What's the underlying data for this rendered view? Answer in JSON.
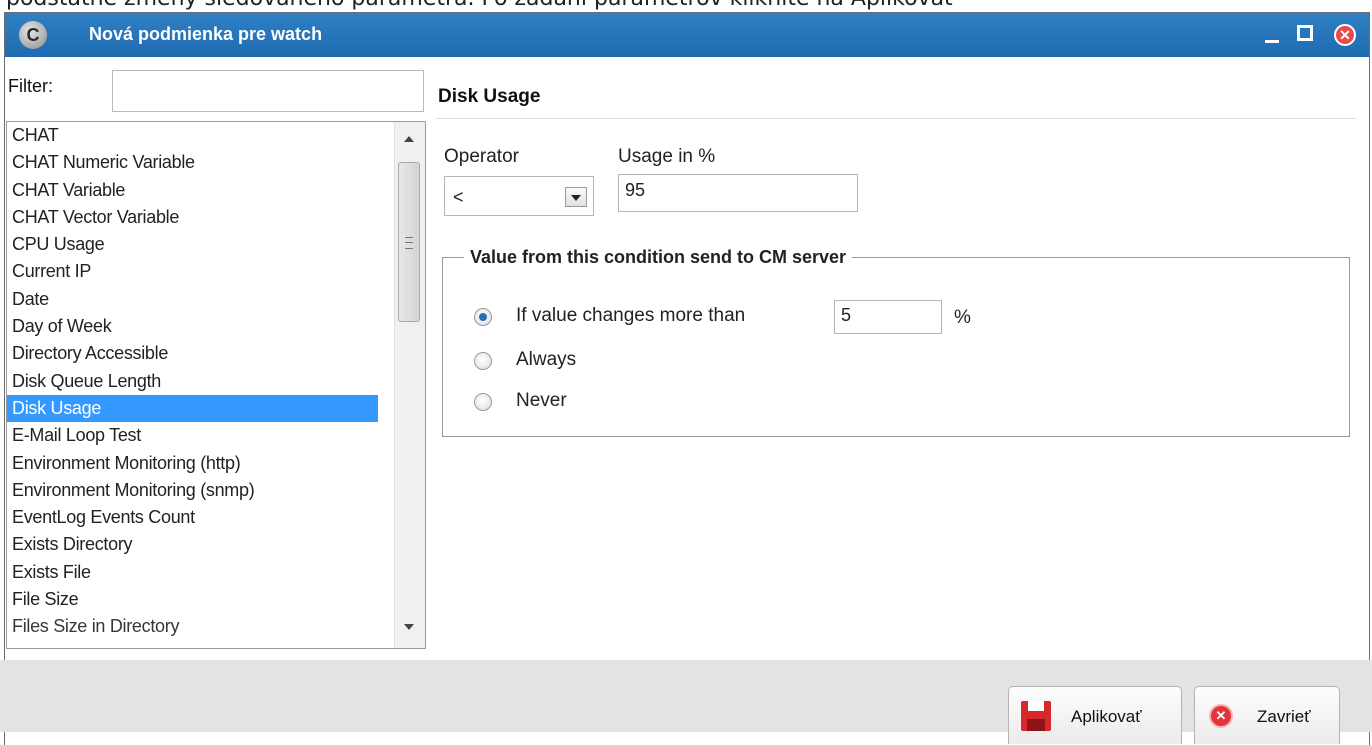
{
  "page_banner": "podstatné zmeny sledovaného parametra. Po zadaní parametrov kliknite na Aplikovať",
  "window": {
    "app_icon_glyph": "C",
    "title": "Nová podmienka pre watch",
    "close_glyph": "✕"
  },
  "filter": {
    "label": "Filter:",
    "value": ""
  },
  "conditions": {
    "items": [
      "CHAT",
      "CHAT Numeric Variable",
      "CHAT Variable",
      "CHAT Vector Variable",
      "CPU Usage",
      "Current IP",
      "Date",
      "Day of Week",
      "Directory Accessible",
      "Disk Queue Length",
      "Disk Usage",
      "E-Mail Loop Test",
      "Environment Monitoring (http)",
      "Environment Monitoring (snmp)",
      "EventLog Events Count",
      "Exists Directory",
      "Exists File",
      "File Size",
      "Files Size in Directory"
    ],
    "selected": "Disk Usage"
  },
  "detail": {
    "title": "Disk Usage",
    "operator_label": "Operator",
    "operator_value": "<",
    "usage_label": "Usage in %",
    "usage_value": "95"
  },
  "send_group": {
    "legend": "Value from this condition send to CM server",
    "option_change": "If value changes more than",
    "change_value": "5",
    "change_unit": "%",
    "option_always": "Always",
    "option_never": "Never",
    "selected_option": "If value changes more than"
  },
  "footer": {
    "apply_label": "Aplikovať",
    "close_label": "Zavrieť",
    "close_icon_glyph": "✕"
  },
  "colors": {
    "titlebar": "#1f6ab1",
    "selection": "#3399ff",
    "close_red": "#e74b4b",
    "save_red": "#d9272e"
  }
}
